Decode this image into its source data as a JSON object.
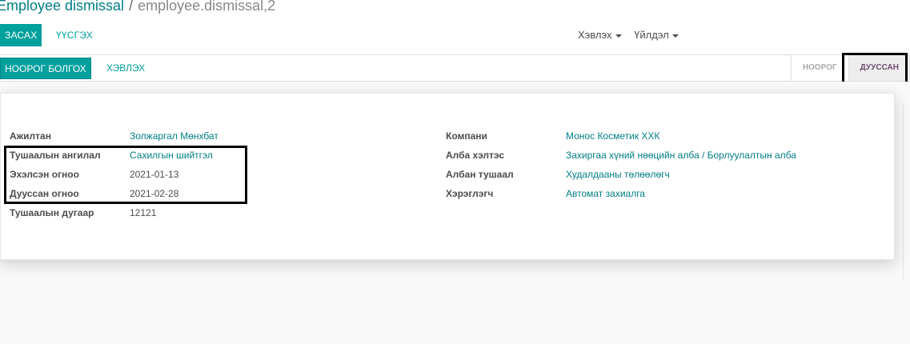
{
  "breadcrumb": {
    "parent": "Employee dismissal",
    "separator": "/",
    "current": "employee.dismissal,2"
  },
  "toolbar": {
    "edit_label": "ЗАСАХ",
    "create_label": "ҮҮСГЭХ",
    "print_label": "Хэвлэх",
    "action_label": "Үйлдэл"
  },
  "statusbar": {
    "draft_button": "НООРОГ БОЛГОХ",
    "print_button": "ХЭВЛЭХ",
    "stages": [
      {
        "label": "НООРОГ",
        "active": false
      },
      {
        "label": "ДУУССАН",
        "active": true
      }
    ]
  },
  "form": {
    "left": [
      {
        "label": "Ажилтан",
        "value": "Золжаргал Мөнхбат",
        "link": true
      },
      {
        "label": "Тушаалын ангилал",
        "value": "Сахилгын шийтгэл",
        "link": true
      },
      {
        "label": "Эхэлсэн огноо",
        "value": "2021-01-13",
        "link": false
      },
      {
        "label": "Дууссан огноо",
        "value": "2021-02-28",
        "link": false
      },
      {
        "label": "Тушаалын дугаар",
        "value": "12121",
        "link": false
      }
    ],
    "right": [
      {
        "label": "Компани",
        "value": "Монос Косметик ХХК",
        "link": true
      },
      {
        "label": "Алба хэлтэс",
        "value": "Захиргаа хүний нөөцийн алба / Борлуулалтын алба",
        "link": true
      },
      {
        "label": "Албан тушаал",
        "value": "Худалдааны төлөөлөгч",
        "link": true
      },
      {
        "label": "Хэрэглэгч",
        "value": "Автомат захиалга",
        "link": true
      }
    ]
  },
  "colors": {
    "accent": "#00a09d",
    "link": "#017e84",
    "active_stage": "#6d4a6a"
  }
}
